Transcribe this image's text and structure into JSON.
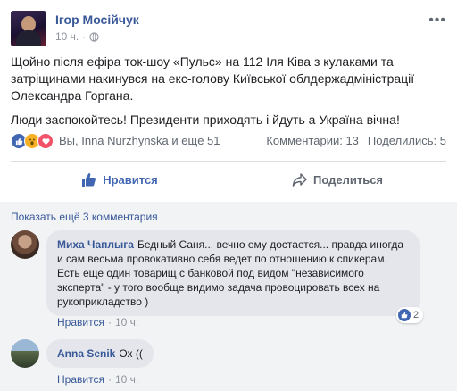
{
  "post": {
    "author": "Ігор Мосійчук",
    "time": "10 ч.",
    "paragraphs": [
      "Щойно після ефіра ток-шоу «Пульс» на 112 Іля Ківа з кулаками та затріщинами накинувся на екс-голову Київської облдержадміністрації Олександра Горгана.",
      "Люди заспокойтесь! Президенти приходять і йдуть а Україна вічна!"
    ],
    "reactions": {
      "names": "Вы, Inna Nurzhynska и ещё 51",
      "comments": "Комментарии: 13",
      "shares": "Поделились: 5"
    },
    "actions": {
      "like": "Нравится",
      "share": "Поделиться"
    }
  },
  "comments": {
    "show_more": "Показать ещё 3 комментария",
    "items": [
      {
        "name": "Миха Чаплыга",
        "text": "Бедный Саня... вечно ему достается... правда иногда и сам весьма провокативно себя ведет по отношению к спикерам. Есть еще один товарищ с банковой под видом \"независимого эксперта\" - у того вообще видимо задача провоцировать всех на рукоприкладство )",
        "like_label": "Нравится",
        "time": "10 ч.",
        "likes": "2"
      },
      {
        "name": "Anna Senik",
        "text": "Ох ((",
        "like_label": "Нравится",
        "time": "10 ч."
      }
    ]
  },
  "colors": {
    "link": "#385898",
    "like_blue": "#4267b2",
    "meta_gray": "#90949c",
    "comment_bg": "#f2f3f5"
  }
}
